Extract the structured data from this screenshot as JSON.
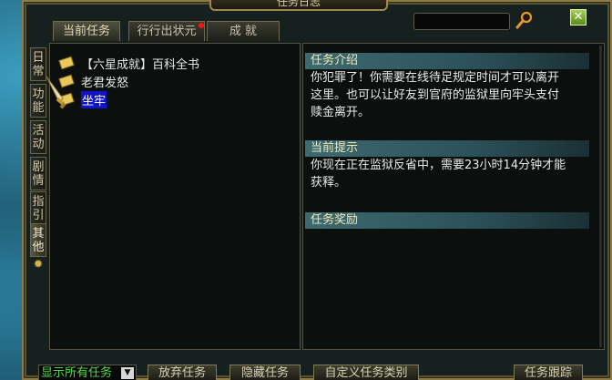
{
  "window": {
    "title": "任务日志"
  },
  "search": {
    "value": "",
    "placeholder": ""
  },
  "tabs": [
    {
      "label": "当前任务",
      "active": true
    },
    {
      "label": "行行出状元",
      "active": false,
      "has_alert": true
    },
    {
      "label": "成 就",
      "active": false
    }
  ],
  "side_tabs": [
    {
      "label": [
        "日",
        "常"
      ],
      "active": false
    },
    {
      "label": [
        "功",
        "能"
      ],
      "active": false
    },
    {
      "label": [
        "活",
        "动"
      ],
      "active": false
    },
    {
      "label": [
        "剧",
        "情"
      ],
      "active": false
    },
    {
      "label": [
        "指",
        "引"
      ],
      "active": false
    },
    {
      "label": [
        "其",
        "他"
      ],
      "active": true
    }
  ],
  "quest_list": [
    {
      "text": "【六星成就】百科全书",
      "selected": false,
      "icon": "scroll-icon"
    },
    {
      "text": "老君发怒",
      "selected": false,
      "icon": "scroll-icon"
    },
    {
      "text": "坐牢",
      "selected": true,
      "icon": "scroll-icon"
    }
  ],
  "detail": {
    "intro_title": "任务介绍",
    "intro_lines": [
      "你犯罪了！你需要在线待足规定时间才可以离开",
      "这里。也可以让好友到官府的监狱里向牢头支付",
      "赎金离开。"
    ],
    "hint_title": "当前提示",
    "hint_lines": [
      "你现在正在监狱反省中，需要23小时14分钟才能",
      "获释。"
    ],
    "reward_title": "任务奖励"
  },
  "bottom": {
    "show_all": "显示所有任务",
    "abandon": "放弃任务",
    "hide": "隐藏任务",
    "custom": "自定义任务类别",
    "track": "任务跟踪"
  },
  "colors": {
    "frame_gold": "#8c7a45",
    "section_header": "#2b5158",
    "selected_item": "#1212c9",
    "show_all_text": "#54d94a",
    "alert_dot": "#ff1010"
  }
}
